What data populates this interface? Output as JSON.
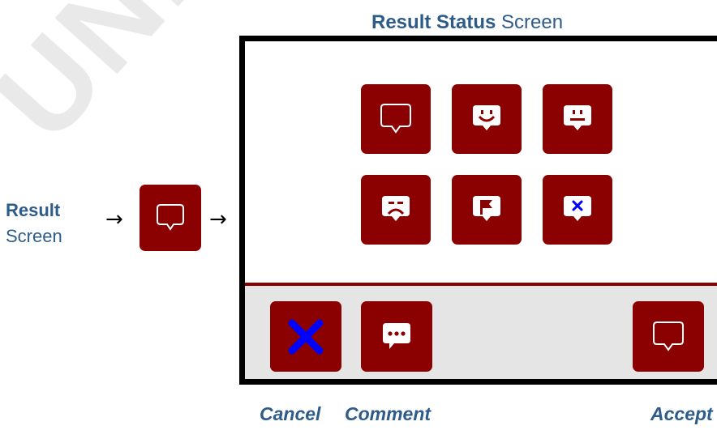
{
  "watermark": "UNIQUE",
  "title": {
    "bold": "Result Status",
    "rest": " Screen"
  },
  "left_label": {
    "line1": "Result",
    "line2": "Screen"
  },
  "arrows": {
    "left": "→",
    "right": "→"
  },
  "status_icons": [
    "empty-speech-bubble-icon",
    "smiling-face-bubble-icon",
    "neutral-face-bubble-icon",
    "sad-face-bubble-icon",
    "flag-bubble-icon",
    "x-mark-bubble-icon"
  ],
  "bottom_bar": {
    "cancel": {
      "label": "Cancel",
      "icon": "blue-x-icon"
    },
    "comment": {
      "label": "Comment",
      "icon": "ellipsis-speech-bubble-icon"
    },
    "accept": {
      "label": "Accept",
      "icon": "empty-speech-bubble-icon"
    }
  },
  "colors": {
    "tile": "#8b0000",
    "label_blue": "#2e5c8a",
    "bar_gray": "#e5e5e5",
    "cancel_x": "#0000ff"
  }
}
